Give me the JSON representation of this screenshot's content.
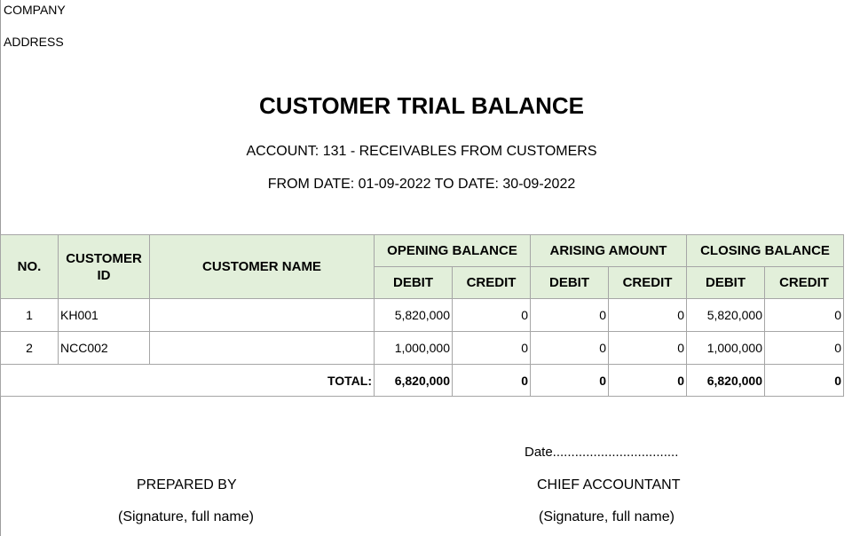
{
  "header": {
    "company": "COMPANY",
    "address": "ADDRESS",
    "title": "CUSTOMER TRIAL BALANCE",
    "account": "ACCOUNT: 131 - RECEIVABLES FROM CUSTOMERS",
    "period": "FROM DATE: 01-09-2022 TO DATE: 30-09-2022"
  },
  "table": {
    "headers": {
      "no": "NO.",
      "customer_id": "CUSTOMER ID",
      "customer_name": "CUSTOMER NAME",
      "opening_balance": "OPENING BALANCE",
      "arising_amount": "ARISING AMOUNT",
      "closing_balance": "CLOSING BALANCE",
      "debit": "DEBIT",
      "credit": "CREDIT"
    },
    "rows": [
      {
        "no": "1",
        "customer_id": "KH001",
        "customer_name": "",
        "opening_debit": "5,820,000",
        "opening_credit": "0",
        "arising_debit": "0",
        "arising_credit": "0",
        "closing_debit": "5,820,000",
        "closing_credit": "0"
      },
      {
        "no": "2",
        "customer_id": "NCC002",
        "customer_name": "",
        "opening_debit": "1,000,000",
        "opening_credit": "0",
        "arising_debit": "0",
        "arising_credit": "0",
        "closing_debit": "1,000,000",
        "closing_credit": "0"
      }
    ],
    "total": {
      "label": "TOTAL:",
      "opening_debit": "6,820,000",
      "opening_credit": "0",
      "arising_debit": "0",
      "arising_credit": "0",
      "closing_debit": "6,820,000",
      "closing_credit": "0"
    }
  },
  "footer": {
    "date_line": "Date..................................",
    "prepared_by": "PREPARED BY",
    "prepared_signature": "(Signature, full name)",
    "chief_accountant": "CHIEF ACCOUNTANT",
    "chief_signature": "(Signature, full name)"
  }
}
